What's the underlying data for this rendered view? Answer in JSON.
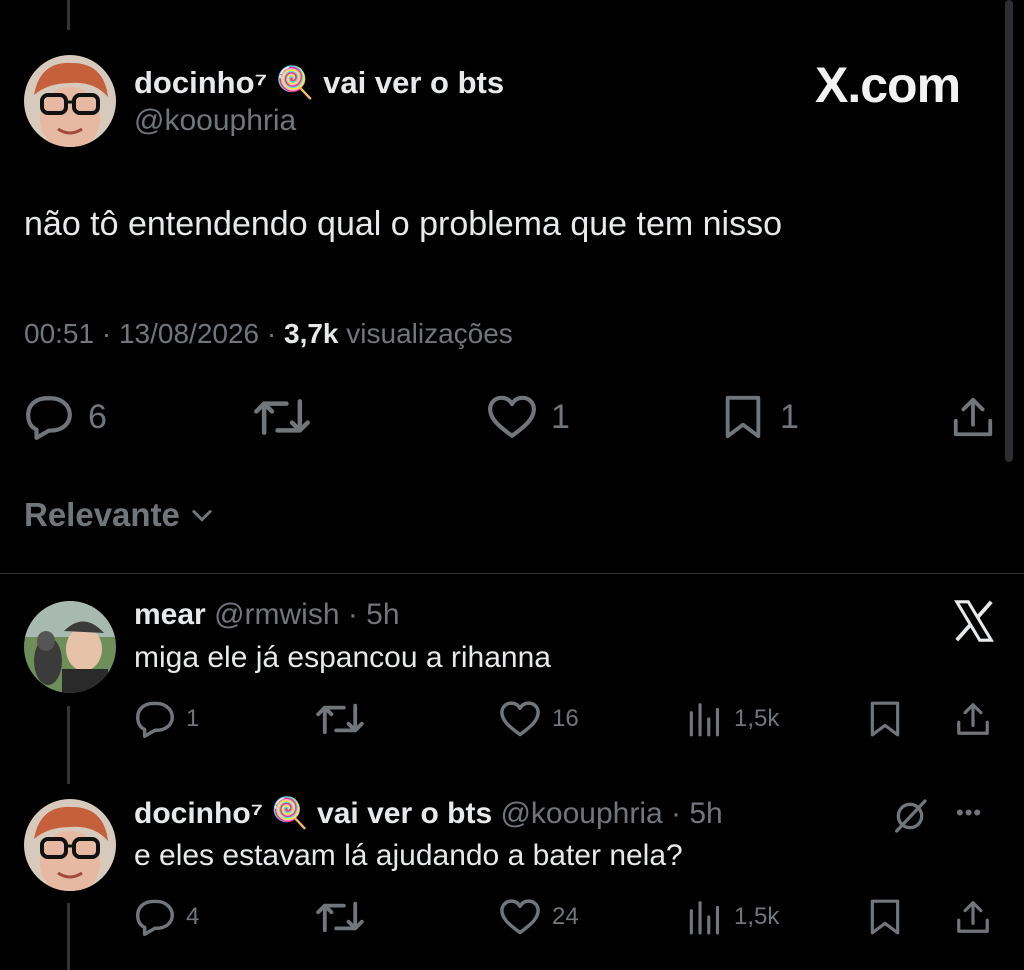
{
  "main_tweet": {
    "display_name": "docinho⁷ 🍭 vai ver o bts",
    "handle": "@koouphria",
    "brand": "X.com",
    "text": "não tô entendendo qual o problema que tem nisso",
    "time": "00:51",
    "sep1": "·",
    "date": "13/08/2026",
    "sep2": "·",
    "views_count": "3,7k",
    "views_label": "visualizações",
    "replies": "6",
    "likes": "1",
    "bookmarks": "1"
  },
  "sort": {
    "label": "Relevante"
  },
  "replies": [
    {
      "display_name": "mear",
      "handle": "@rmwish",
      "time": "· 5h",
      "text": "miga ele já espancou a rihanna",
      "replies": "1",
      "likes": "16",
      "views": "1,5k"
    },
    {
      "display_name": "docinho⁷ 🍭 vai ver o bts",
      "handle": "@koouphria",
      "time": "· 5h",
      "text": "e eles estavam lá ajudando a bater nela?",
      "replies": "4",
      "likes": "24",
      "views": "1,5k",
      "more": "•••"
    }
  ],
  "colors": {
    "background": "#000000",
    "text": "#e7e9ea",
    "muted": "#71767b",
    "divider": "#2f3336"
  }
}
